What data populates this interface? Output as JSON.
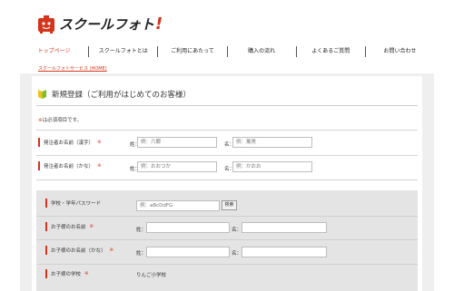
{
  "header": {
    "logo_text": "スクールフォト",
    "logo_excl": "!"
  },
  "nav": {
    "items": [
      {
        "label": "トップページ",
        "active": true
      },
      {
        "label": "スクールフォトとは",
        "active": false
      },
      {
        "label": "ご利用にあたって",
        "active": false
      },
      {
        "label": "購入の流れ",
        "active": false
      },
      {
        "label": "よくあるご質問",
        "active": false
      },
      {
        "label": "お問い合わせ",
        "active": false
      }
    ]
  },
  "breadcrumb": "スクールフォトサービス (HOME)",
  "section": {
    "title": "新規登録（ご利用がはじめてのお客様）"
  },
  "required_note": {
    "mark": "※",
    "text": "は必須項目です。"
  },
  "form": {
    "orderer_name_kanji": {
      "label": "発注者お名前（漢字）",
      "req": "※",
      "last_prefix": "姓：",
      "last_placeholder": "例：六郷",
      "first_prefix": "名：",
      "first_placeholder": "例：薫男"
    },
    "orderer_name_kana": {
      "label": "発注者お名前（かな）",
      "req": "※",
      "last_prefix": "姓：",
      "last_placeholder": "例：おおつか",
      "first_prefix": "名：",
      "first_placeholder": "例：かおお"
    },
    "school_password": {
      "label": "学校・学年パスワード",
      "placeholder": "例：aBcDdFG",
      "search_button": "検索"
    },
    "child_name": {
      "label": "お子様のお名前",
      "req": "※",
      "last_prefix": "姓：",
      "first_prefix": "名："
    },
    "child_name_kana": {
      "label": "お子様のお名前（かな）",
      "req": "※",
      "last_prefix": "姓：",
      "first_prefix": "名："
    },
    "child_school": {
      "label": "お子様の学校",
      "req": "※",
      "value": "りんご小学校"
    }
  },
  "colors": {
    "accent": "#d4341c",
    "leaf_green": "#7cbf2a",
    "leaf_yellow": "#f2c21b"
  }
}
